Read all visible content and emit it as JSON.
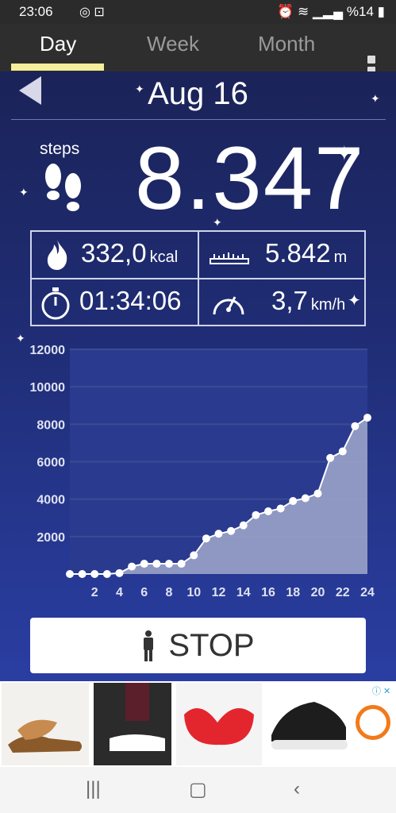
{
  "status": {
    "time": "23:06",
    "battery": "%14"
  },
  "tabs": [
    {
      "label": "Day"
    },
    {
      "label": "Week"
    },
    {
      "label": "Month"
    }
  ],
  "date": "Aug 16",
  "steps_label": "steps",
  "steps_value": "8.347",
  "stats": {
    "calories": {
      "value": "332,0",
      "unit": "kcal"
    },
    "distance": {
      "value": "5.842",
      "unit": "m"
    },
    "duration": {
      "value": "01:34:06"
    },
    "speed": {
      "value": "3,7",
      "unit": "km/h"
    }
  },
  "chart_data": {
    "type": "area",
    "x": [
      0,
      1,
      2,
      3,
      4,
      5,
      6,
      7,
      8,
      9,
      10,
      11,
      12,
      13,
      14,
      15,
      16,
      17,
      18,
      19,
      20,
      21,
      22,
      23,
      24
    ],
    "values": [
      0,
      0,
      0,
      0,
      50,
      400,
      550,
      550,
      550,
      550,
      1000,
      1900,
      2150,
      2300,
      2600,
      3150,
      3350,
      3500,
      3900,
      4050,
      4300,
      6200,
      6550,
      7900,
      8350
    ],
    "ylim": [
      0,
      12000
    ],
    "yticks": [
      "2000",
      "4000",
      "6000",
      "8000",
      "10000",
      "12000"
    ],
    "xticks": [
      "2",
      "4",
      "6",
      "8",
      "10",
      "12",
      "14",
      "16",
      "18",
      "20",
      "22",
      "24"
    ],
    "grid": true,
    "colors": {
      "fill": "#9aa3c8",
      "line": "#ffffff",
      "grid": "#3c4b93"
    }
  },
  "stop_button": {
    "label": "STOP"
  }
}
